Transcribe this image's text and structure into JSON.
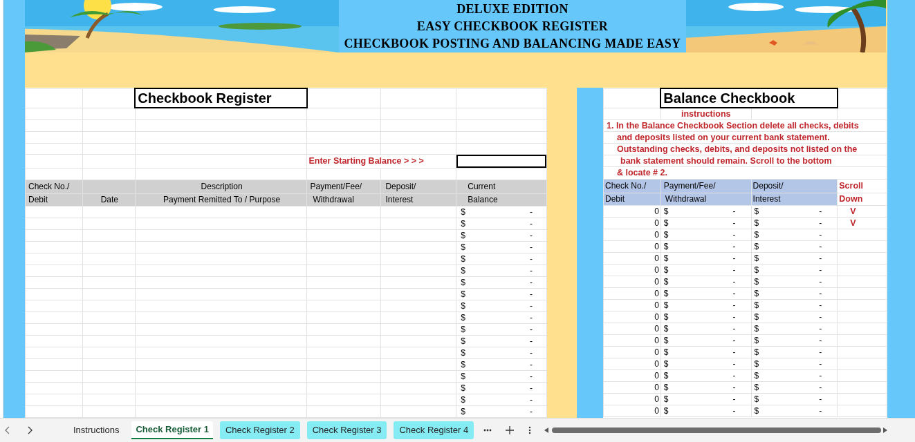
{
  "header": {
    "title_lines": [
      "DELUXE EDITION",
      "EASY CHECKBOOK REGISTER",
      "CHECKBOOK POSTING AND BALANCING MADE EASY"
    ]
  },
  "register": {
    "title": "Checkbook Register",
    "starting_balance_label": "Enter Starting Balance > > >",
    "columns": [
      {
        "top": "Check No./",
        "bottom": "Debit"
      },
      {
        "bottom": "Date"
      },
      {
        "top": "Description",
        "bottom": "Payment Remitted To / Purpose"
      },
      {
        "top": "Payment/Fee/",
        "bottom": "Withdrawal"
      },
      {
        "top": "Deposit/",
        "bottom": "Interest"
      },
      {
        "top": "Current",
        "bottom": "Balance"
      }
    ],
    "rows": [
      {
        "balance_symbol": "$",
        "balance": "-"
      },
      {
        "balance_symbol": "$",
        "balance": "-"
      },
      {
        "balance_symbol": "$",
        "balance": "-"
      },
      {
        "balance_symbol": "$",
        "balance": "-"
      },
      {
        "balance_symbol": "$",
        "balance": "-"
      },
      {
        "balance_symbol": "$",
        "balance": "-"
      },
      {
        "balance_symbol": "$",
        "balance": "-"
      },
      {
        "balance_symbol": "$",
        "balance": "-"
      },
      {
        "balance_symbol": "$",
        "balance": "-"
      },
      {
        "balance_symbol": "$",
        "balance": "-"
      },
      {
        "balance_symbol": "$",
        "balance": "-"
      },
      {
        "balance_symbol": "$",
        "balance": "-"
      },
      {
        "balance_symbol": "$",
        "balance": "-"
      },
      {
        "balance_symbol": "$",
        "balance": "-"
      },
      {
        "balance_symbol": "$",
        "balance": "-"
      },
      {
        "balance_symbol": "$",
        "balance": "-"
      },
      {
        "balance_symbol": "$",
        "balance": "-"
      },
      {
        "balance_symbol": "$",
        "balance": "-"
      }
    ]
  },
  "balance_checkbook": {
    "title": "Balance Checkbook",
    "instructions_label": "instructions",
    "instructions": [
      "1. In the Balance Checkbook Section delete all checks, debits",
      "and deposits listed on your current bank statement.",
      "Outstanding checks, debits, and deposits not listed on the",
      "bank statement should remain. Scroll to the bottom",
      "& locate # 2."
    ],
    "columns": [
      {
        "top": "Check No./",
        "bottom": "Debit"
      },
      {
        "top": "Payment/Fee/",
        "bottom": "Withdrawal"
      },
      {
        "top": "Deposit/",
        "bottom": "Interest"
      },
      {
        "top": "Scroll",
        "bottom": "Down"
      }
    ],
    "rows": [
      {
        "check_no": "0",
        "payment_symbol": "$",
        "payment": "-",
        "deposit_symbol": "$",
        "deposit": "-",
        "scroll": "V"
      },
      {
        "check_no": "0",
        "payment_symbol": "$",
        "payment": "-",
        "deposit_symbol": "$",
        "deposit": "-",
        "scroll": "V"
      },
      {
        "check_no": "0",
        "payment_symbol": "$",
        "payment": "-",
        "deposit_symbol": "$",
        "deposit": "-"
      },
      {
        "check_no": "0",
        "payment_symbol": "$",
        "payment": "-",
        "deposit_symbol": "$",
        "deposit": "-"
      },
      {
        "check_no": "0",
        "payment_symbol": "$",
        "payment": "-",
        "deposit_symbol": "$",
        "deposit": "-"
      },
      {
        "check_no": "0",
        "payment_symbol": "$",
        "payment": "-",
        "deposit_symbol": "$",
        "deposit": "-"
      },
      {
        "check_no": "0",
        "payment_symbol": "$",
        "payment": "-",
        "deposit_symbol": "$",
        "deposit": "-"
      },
      {
        "check_no": "0",
        "payment_symbol": "$",
        "payment": "-",
        "deposit_symbol": "$",
        "deposit": "-"
      },
      {
        "check_no": "0",
        "payment_symbol": "$",
        "payment": "-",
        "deposit_symbol": "$",
        "deposit": "-"
      },
      {
        "check_no": "0",
        "payment_symbol": "$",
        "payment": "-",
        "deposit_symbol": "$",
        "deposit": "-"
      },
      {
        "check_no": "0",
        "payment_symbol": "$",
        "payment": "-",
        "deposit_symbol": "$",
        "deposit": "-"
      },
      {
        "check_no": "0",
        "payment_symbol": "$",
        "payment": "-",
        "deposit_symbol": "$",
        "deposit": "-"
      },
      {
        "check_no": "0",
        "payment_symbol": "$",
        "payment": "-",
        "deposit_symbol": "$",
        "deposit": "-"
      },
      {
        "check_no": "0",
        "payment_symbol": "$",
        "payment": "-",
        "deposit_symbol": "$",
        "deposit": "-"
      },
      {
        "check_no": "0",
        "payment_symbol": "$",
        "payment": "-",
        "deposit_symbol": "$",
        "deposit": "-"
      },
      {
        "check_no": "0",
        "payment_symbol": "$",
        "payment": "-",
        "deposit_symbol": "$",
        "deposit": "-"
      },
      {
        "check_no": "0",
        "payment_symbol": "$",
        "payment": "-",
        "deposit_symbol": "$",
        "deposit": "-"
      },
      {
        "check_no": "0",
        "payment_symbol": "$",
        "payment": "-",
        "deposit_symbol": "$",
        "deposit": "-"
      }
    ]
  },
  "sheet_tabs": [
    {
      "label": "Instructions",
      "selected": false
    },
    {
      "label": "Check Register 1",
      "selected": true
    },
    {
      "label": "Check Register 2",
      "selected": false,
      "color": "#86ecf3"
    },
    {
      "label": "Check Register 3",
      "selected": false,
      "color": "#86ecf3"
    },
    {
      "label": "Check Register 4",
      "selected": false,
      "color": "#86ecf3"
    }
  ]
}
